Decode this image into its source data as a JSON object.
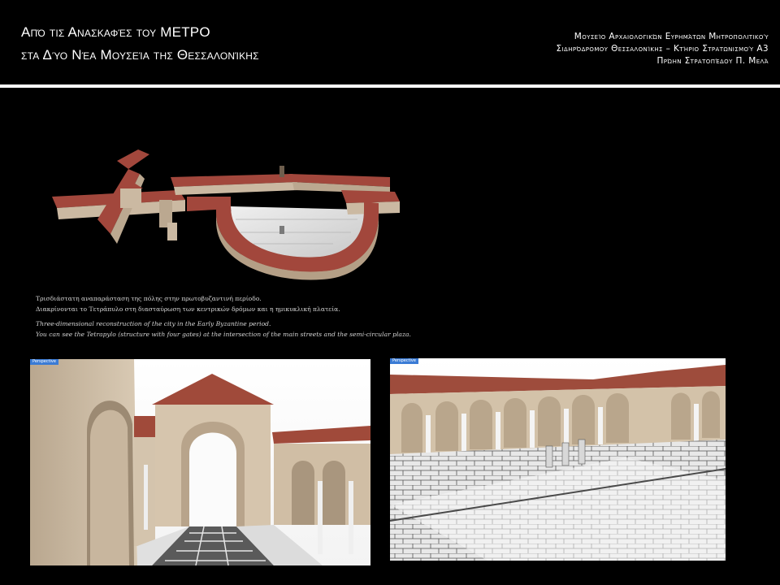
{
  "header": {
    "title_line1": "Από τις Ανασκαφές του ΜΕΤΡΟ",
    "title_line2": "στα Δύο Νέα Μουσεία της Θεσσαλονίκης",
    "museum_line1": "Μουσείο Αρχαιολογικών Ευρημάτων Μητροπολιτικού",
    "museum_line2": "Σιδηρόδρομου Θεσσαλονίκης – Κτήριο Στρατωνισμού Α3",
    "museum_line3": "Πρώην Στρατοπέδου Π. Μελά"
  },
  "caption": {
    "greek_line1": "Τρισδιάστατη αναπαράσταση της πόλης στην πρωτοβυζαντινή περίοδο.",
    "greek_line2": "Διακρίνονται το Τετράπυλο στη διασταύρωση των κεντρικών δρόμων και η ημικυκλική πλατεία.",
    "english_line1": "Three-dimensional reconstruction of the city in the Early Byzantine period.",
    "english_line2": "You can see the Tetrapylo (structure with four gates) at the intersection of the main streets and the semi-circular plaza."
  },
  "images": {
    "aerial_alt": "",
    "left_tag": "Perspective",
    "right_tag": "Perspective"
  },
  "colors": {
    "roof": "#a2473c",
    "stone": "#cbb9a2",
    "paving": "#e9e9e9"
  }
}
